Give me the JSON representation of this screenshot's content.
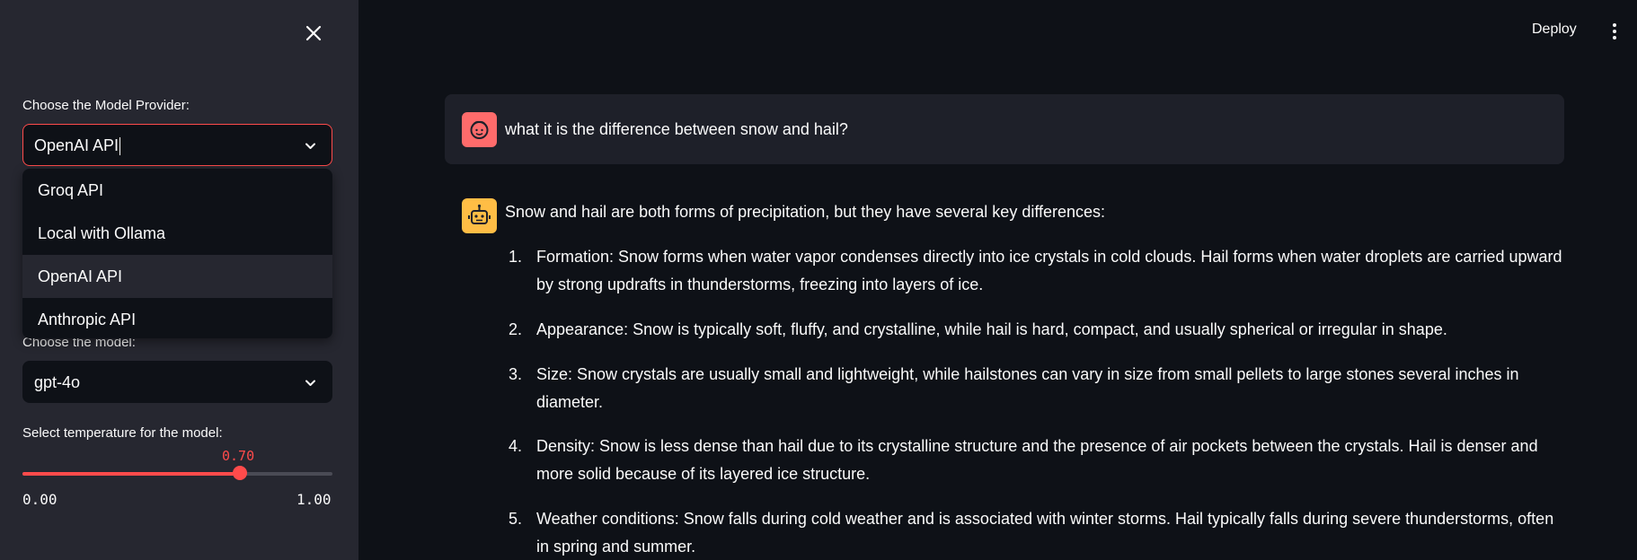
{
  "sidebar": {
    "provider_label": "Choose the Model Provider:",
    "provider_value": "OpenAI API",
    "provider_options": [
      "Groq API",
      "Local with Ollama",
      "OpenAI API",
      "Anthropic API"
    ],
    "model_label": "Choose the model:",
    "model_value": "gpt-4o",
    "temperature_label": "Select temperature for the model:",
    "temperature_value": "0.70",
    "temperature_fraction": 0.7,
    "temperature_min": "0.00",
    "temperature_max": "1.00"
  },
  "header": {
    "deploy_label": "Deploy"
  },
  "chat": {
    "user_message": "what it is the difference between snow and hail?",
    "assistant_intro": "Snow and hail are both forms of precipitation, but they have several key differences:",
    "assistant_items": [
      {
        "num": "1.",
        "text": "Formation: Snow forms when water vapor condenses directly into ice crystals in cold clouds. Hail forms when water droplets are carried upward by strong updrafts in thunderstorms, freezing into layers of ice."
      },
      {
        "num": "2.",
        "text": "Appearance: Snow is typically soft, fluffy, and crystalline, while hail is hard, compact, and usually spherical or irregular in shape."
      },
      {
        "num": "3.",
        "text": "Size: Snow crystals are usually small and lightweight, while hailstones can vary in size from small pellets to large stones several inches in diameter."
      },
      {
        "num": "4.",
        "text": "Density: Snow is less dense than hail due to its crystalline structure and the presence of air pockets between the crystals. Hail is denser and more solid because of its layered ice structure."
      },
      {
        "num": "5.",
        "text": "Weather conditions: Snow falls during cold weather and is associated with winter storms. Hail typically falls during severe thunderstorms, often in spring and summer."
      }
    ]
  },
  "colors": {
    "accent": "#ff4b4b",
    "sidebar_bg": "#262730",
    "main_bg": "#0e1117",
    "user_avatar": "#ff6b6b",
    "assistant_avatar": "#ffbd45"
  },
  "icons": {
    "close": "close-icon",
    "chevron": "chevron-down-icon",
    "menu": "kebab-menu-icon",
    "user_avatar": "user-face-icon",
    "assistant_avatar": "robot-icon"
  }
}
